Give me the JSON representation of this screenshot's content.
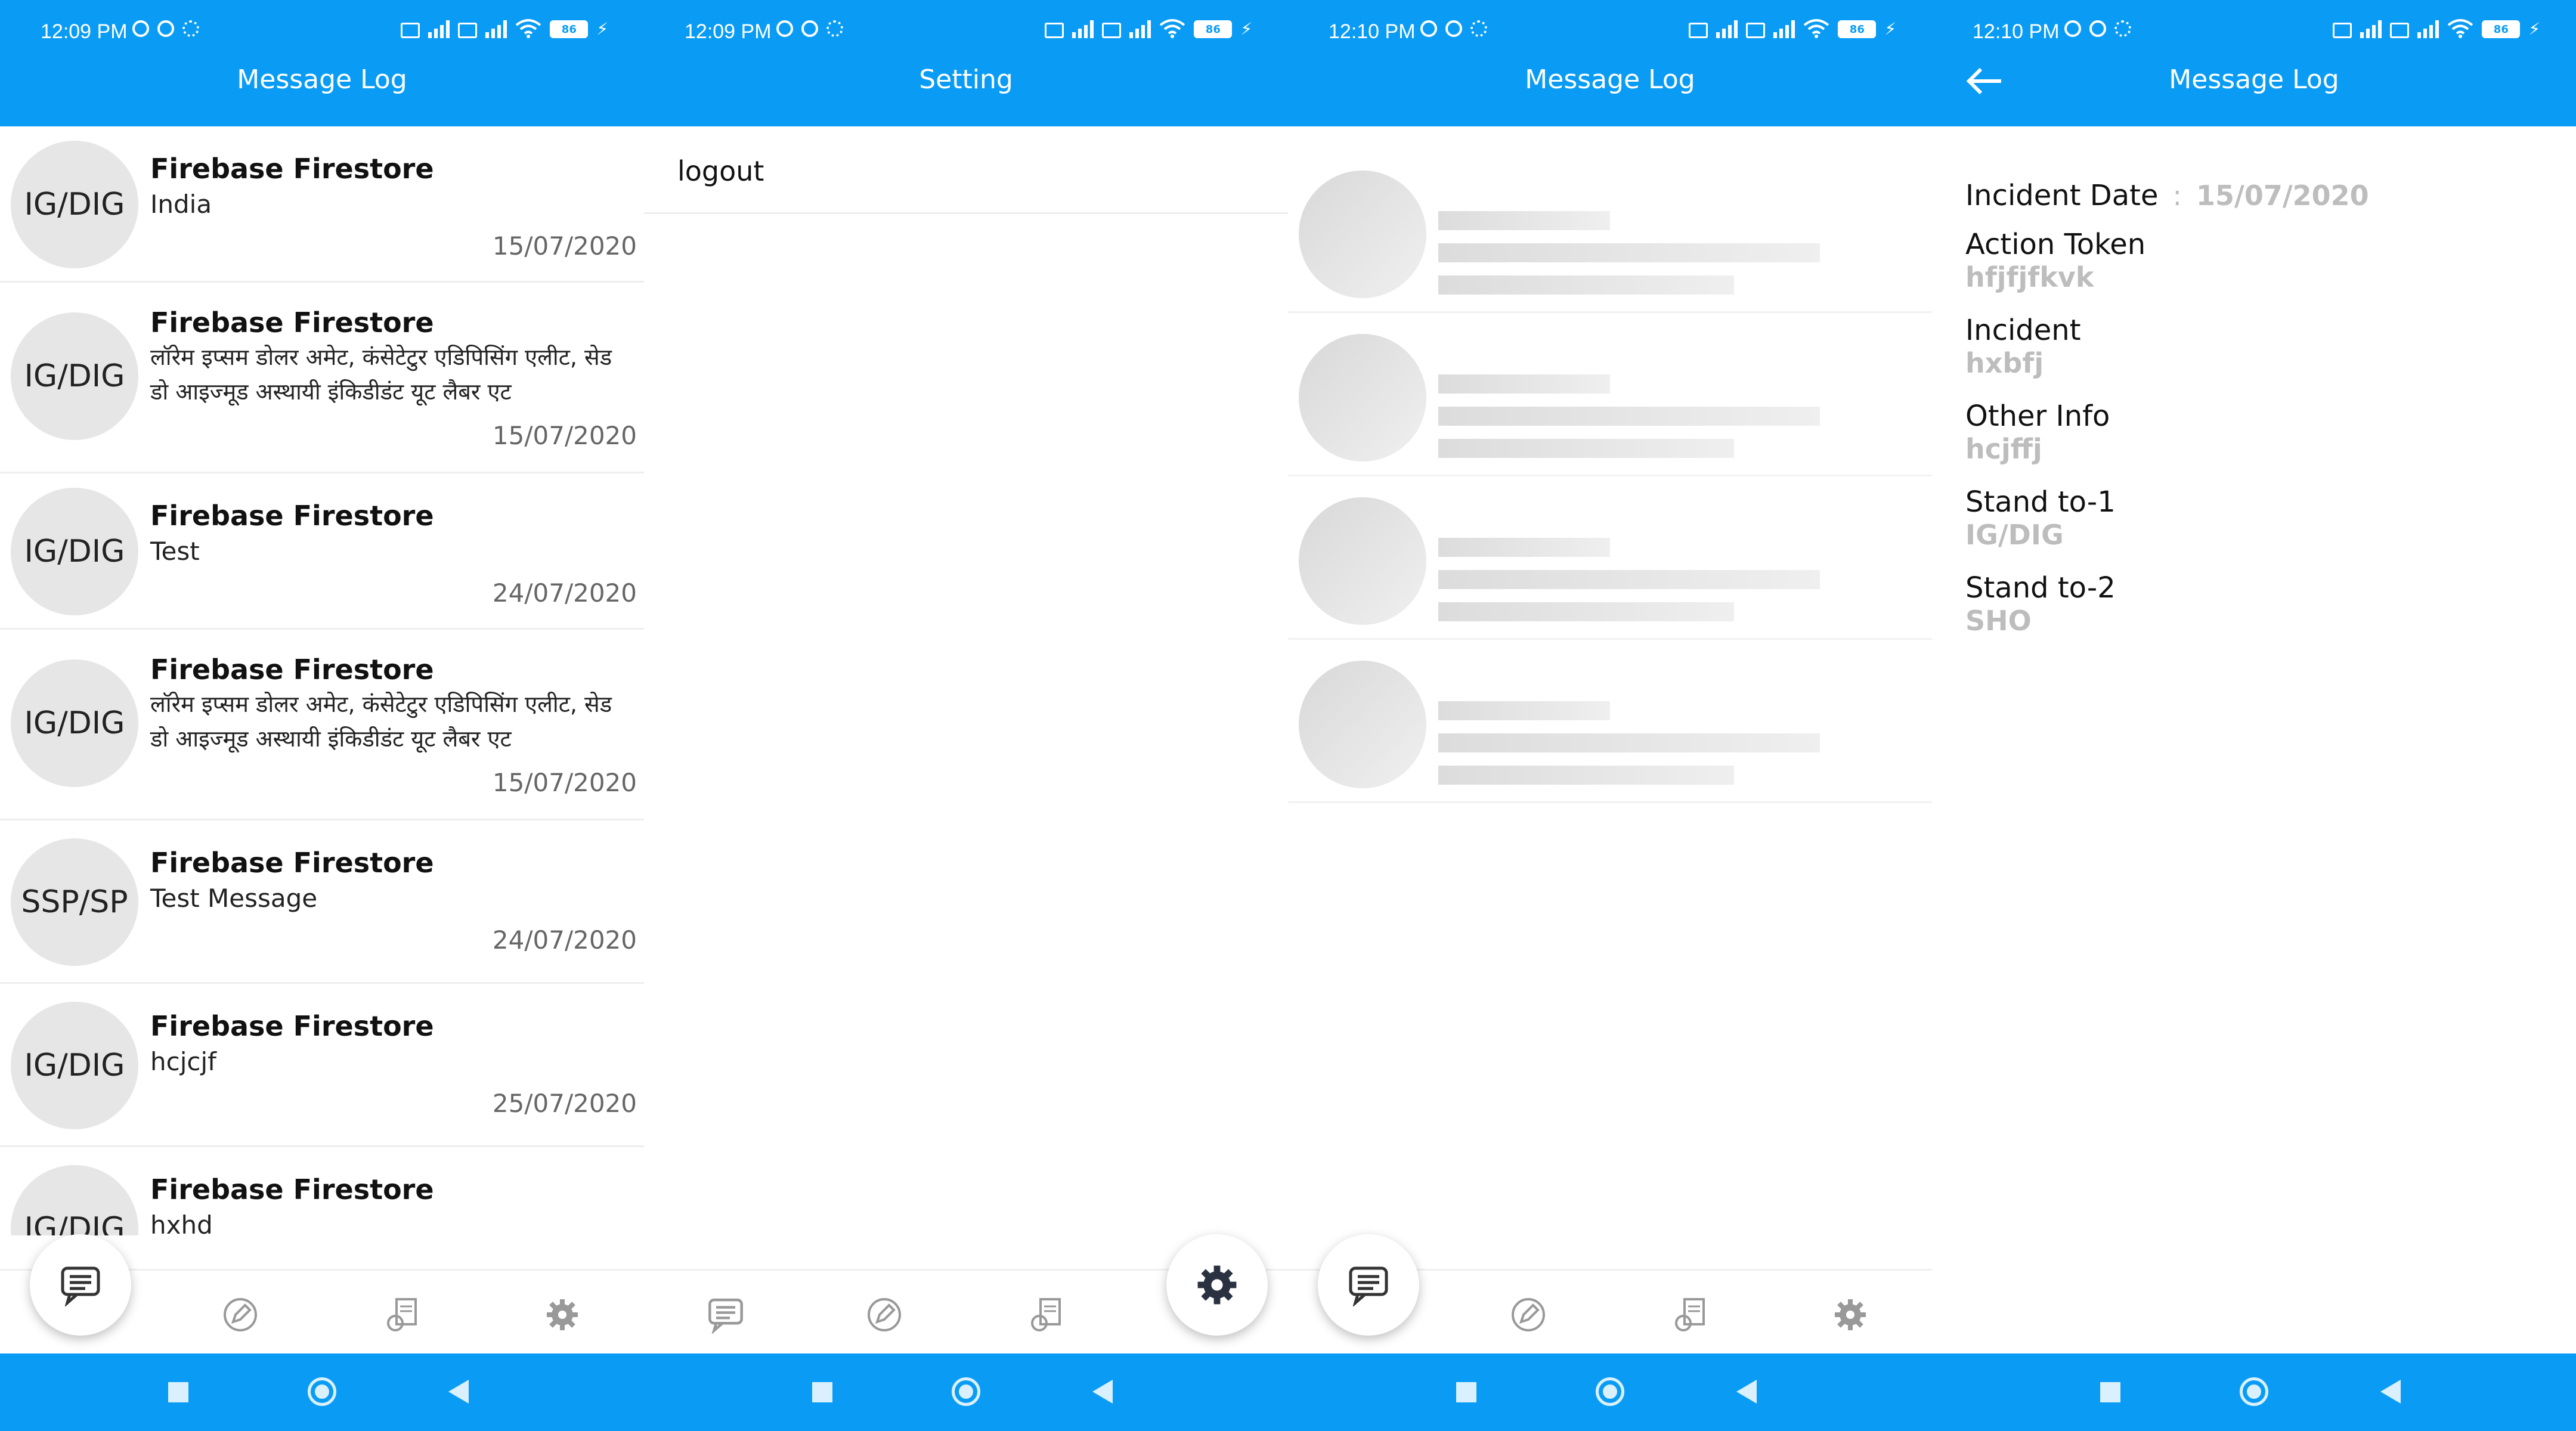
{
  "status_times": [
    "12:09 PM",
    "12:09 PM",
    "12:10 PM",
    "12:10 PM"
  ],
  "battery": "86",
  "panels": {
    "p1": {
      "title": "Message Log"
    },
    "p2": {
      "title": "Setting"
    },
    "p3": {
      "title": "Message Log"
    },
    "p4": {
      "title": "Message Log"
    }
  },
  "messages": [
    {
      "avatar": "IG/DIG",
      "title": "Firebase Firestore",
      "body": "India",
      "date": "15/07/2020"
    },
    {
      "avatar": "IG/DIG",
      "title": "Firebase Firestore",
      "body": "लॉरेम इप्सम डोलर अमेट, कंसेटेटुर एडिपिसिंग एलीट, सेड डो आइज्मूड अस्थायी इंकिडीडंट यूट लैबर एट",
      "date": "15/07/2020"
    },
    {
      "avatar": "IG/DIG",
      "title": "Firebase Firestore",
      "body": "Test",
      "date": "24/07/2020"
    },
    {
      "avatar": "IG/DIG",
      "title": "Firebase Firestore",
      "body": "लॉरेम इप्सम डोलर अमेट, कंसेटेटुर एडिपिसिंग एलीट, सेड डो आइज्मूड अस्थायी इंकिडीडंट यूट लैबर एट",
      "date": "15/07/2020"
    },
    {
      "avatar": "SSP/SP",
      "title": "Firebase Firestore",
      "body": "Test Message",
      "date": "24/07/2020"
    },
    {
      "avatar": "IG/DIG",
      "title": "Firebase Firestore",
      "body": "hcjcjf",
      "date": "25/07/2020"
    },
    {
      "avatar": "IG/DIG",
      "title": "Firebase Firestore",
      "body": "hxhd",
      "date": ""
    }
  ],
  "setting": {
    "logout_label": "logout"
  },
  "detail": {
    "incident_date_label": "Incident Date",
    "incident_date_value": "15/07/2020",
    "action_token_label": "Action Token",
    "action_token_value": "hfjfjfkvk",
    "incident_label": "Incident",
    "incident_value": "hxbfj",
    "other_info_label": "Other Info",
    "other_info_value": "hcjffj",
    "stand_to_1_label": "Stand to-1",
    "stand_to_1_value": "IG/DIG",
    "stand_to_2_label": "Stand to-2",
    "stand_to_2_value": "SHO"
  },
  "nav": {
    "active_tab": [
      "messages",
      "settings",
      "messages",
      "none"
    ],
    "icons": [
      "message-icon",
      "edit-icon",
      "document-icon",
      "gear-icon"
    ]
  },
  "colors": {
    "primary": "#0a9cf5",
    "secondary_text": "#bdbdbd"
  }
}
